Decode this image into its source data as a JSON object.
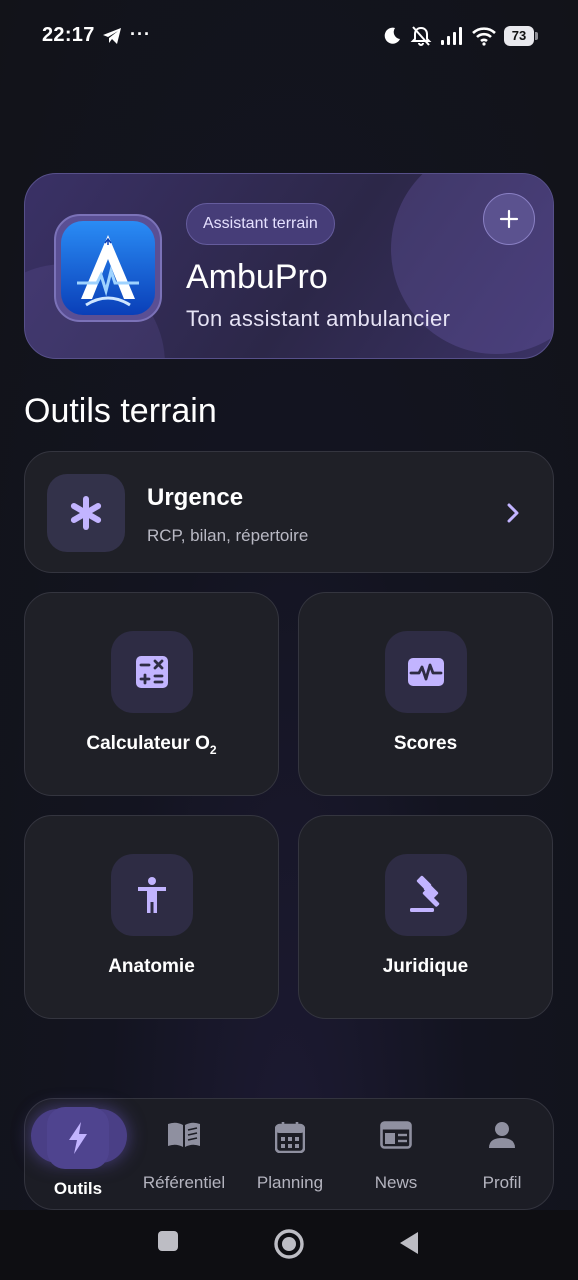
{
  "status_bar": {
    "time": "22:17",
    "more": "···",
    "battery": "73"
  },
  "hero": {
    "badge": "Assistant terrain",
    "title": "AmbuPro",
    "subtitle": "Ton assistant ambulancier"
  },
  "section_title": "Outils terrain",
  "urgence": {
    "title": "Urgence",
    "subtitle": "RCP, bilan, répertoire"
  },
  "tiles": [
    {
      "label": "Calculateur O",
      "sub": "2",
      "icon": "calculator-icon"
    },
    {
      "label": "Scores",
      "icon": "pulse-monitor-icon"
    },
    {
      "label": "Anatomie",
      "icon": "body-icon"
    },
    {
      "label": "Juridique",
      "icon": "gavel-icon"
    }
  ],
  "nav": {
    "items": [
      {
        "label": "Outils",
        "icon": "bolt-icon",
        "active": true
      },
      {
        "label": "Référentiel",
        "icon": "book-icon"
      },
      {
        "label": "Planning",
        "icon": "calendar-icon"
      },
      {
        "label": "News",
        "icon": "newspaper-icon"
      },
      {
        "label": "Profil",
        "icon": "person-icon"
      }
    ]
  },
  "colors": {
    "accent": "#b9a8ff",
    "background": "#121319",
    "card": "#1f2027",
    "hero": "#2c2748"
  }
}
